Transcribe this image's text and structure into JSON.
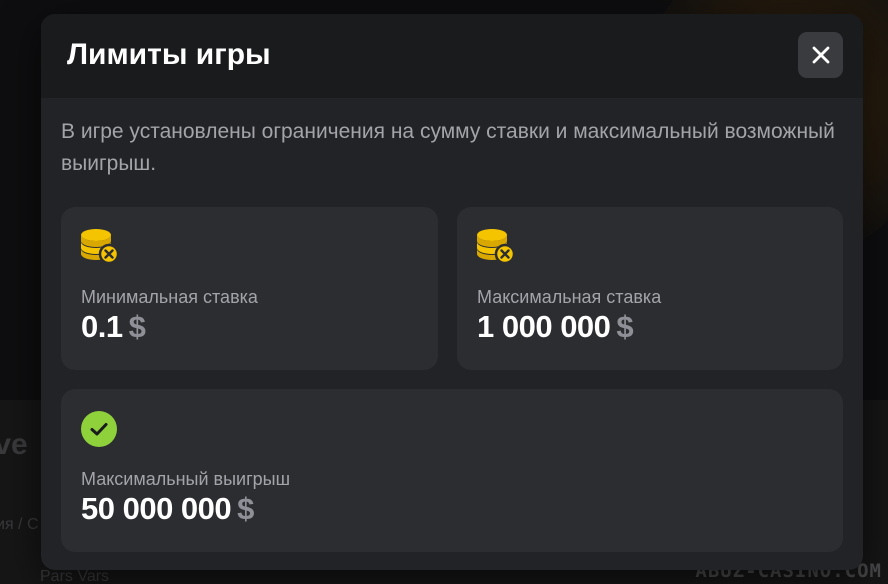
{
  "modal": {
    "title": "Лимиты игры",
    "description": "В игре установлены ограничения на сумму ставки и максимальный возможный выигрыш.",
    "close_icon": "close-icon"
  },
  "limits": [
    {
      "icon": "coins-x-icon",
      "label": "Минимальная ставка",
      "value": "0.1",
      "currency": "$"
    },
    {
      "icon": "coins-x-icon",
      "label": "Максимальная ставка",
      "value": "1 000 000",
      "currency": "$"
    },
    {
      "icon": "check-circle-icon",
      "label": "Максимальный выигрыш",
      "value": "50 000 000",
      "currency": "$"
    }
  ],
  "background": {
    "title_fragment": "ive",
    "breadcrumb_fragment": "ия / С",
    "provider_fragment": "Pars Vars",
    "watermark": "ABUZ-CASINO.COM"
  },
  "colors": {
    "modal_bg": "#222326",
    "header_bg": "#1a1b1d",
    "card_bg": "#2c2d31",
    "coin_yellow": "#f5c400",
    "check_green": "#8fd13b",
    "muted_text": "#a3a4aa"
  }
}
